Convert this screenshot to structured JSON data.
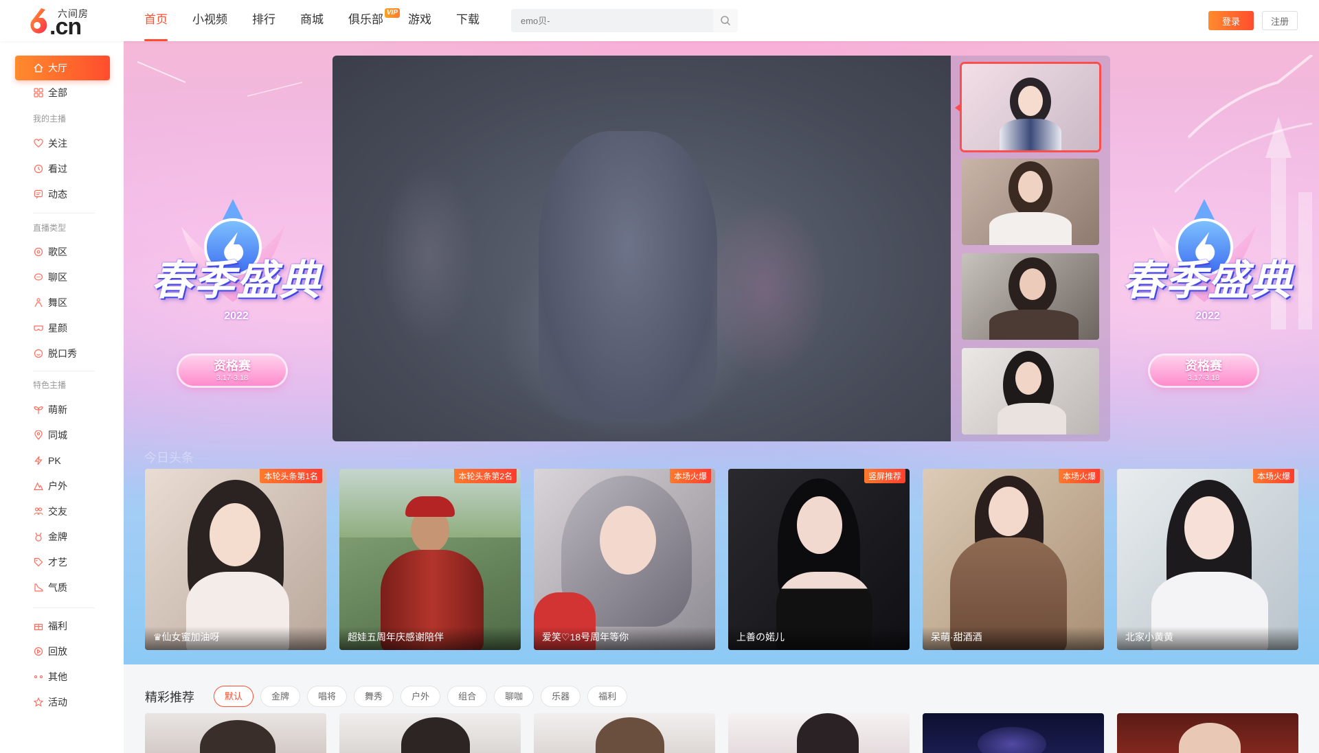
{
  "header": {
    "logo_text": ".cn",
    "logo_sub": "六间房",
    "nav": [
      {
        "label": "首页",
        "active": true
      },
      {
        "label": "小视频"
      },
      {
        "label": "排行"
      },
      {
        "label": "商城"
      },
      {
        "label": "俱乐部",
        "badge": "VIP"
      },
      {
        "label": "游戏"
      },
      {
        "label": "下载"
      }
    ],
    "search_placeholder": "emo贝-",
    "login_label": "登录",
    "register_label": "注册",
    "accent_color": "#ff4d2d"
  },
  "sidebar": {
    "hall": "大厅",
    "all": "全部",
    "group_my": "我的主播",
    "my_items": [
      "关注",
      "看过",
      "动态"
    ],
    "group_type": "直播类型",
    "type_items": [
      "歌区",
      "聊区",
      "舞区",
      "星颜",
      "脱口秀"
    ],
    "group_feature": "特色主播",
    "feature_items": [
      "萌新",
      "同城",
      "PK",
      "户外",
      "交友",
      "金牌",
      "才艺",
      "气质"
    ],
    "other_items": [
      "福利",
      "回放",
      "其他",
      "活动"
    ]
  },
  "promo": {
    "title": "春季盛典",
    "year": "2022",
    "pill_main": "资格赛",
    "pill_date": "3.17-3.18"
  },
  "hero": {
    "section_faint": "今日头条"
  },
  "cards": [
    {
      "tag": "本轮头条第1名",
      "name": "♛仙女蜜加油呀"
    },
    {
      "tag": "本轮头条第2名",
      "name": "超娃五周年庆感谢陪伴"
    },
    {
      "tag": "本场火爆",
      "name": "爱笑♡18号周年等你"
    },
    {
      "tag": "竖屏推荐",
      "name": "上善の婼儿"
    },
    {
      "tag": "本场火爆",
      "name": "呆萌·甜酒酒"
    },
    {
      "tag": "本场火爆",
      "name": "北家小黄黄"
    }
  ],
  "recommend": {
    "title": "精彩推荐",
    "filters": [
      "默认",
      "金牌",
      "唱将",
      "舞秀",
      "户外",
      "组合",
      "聊咖",
      "乐器",
      "福利"
    ],
    "active_filter": "默认"
  }
}
